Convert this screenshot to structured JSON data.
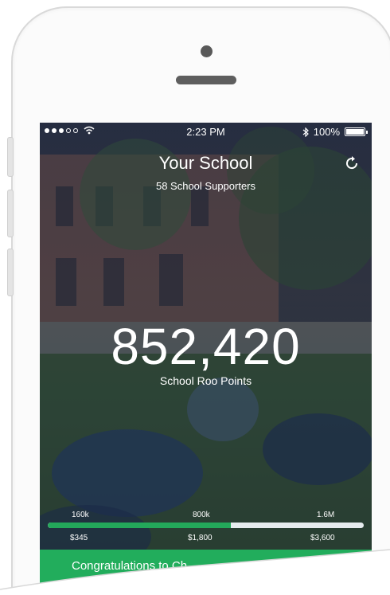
{
  "status_bar": {
    "time": "2:23 PM",
    "battery": "100%"
  },
  "header": {
    "title": "Your School",
    "subtitle": "58 School Supporters"
  },
  "icons": {
    "refresh": "refresh-icon",
    "wifi": "wifi-icon",
    "bluetooth": "bluetooth-icon",
    "battery": "battery-icon",
    "back": "chevron-left-icon"
  },
  "points": {
    "value": "852,420",
    "label": "School Roo Points"
  },
  "progress": {
    "fraction": 0.58,
    "milestones": [
      "160k",
      "800k",
      "1.6M"
    ],
    "amounts": [
      "$345",
      "$1,800",
      "$3,600"
    ]
  },
  "banner": {
    "text": "Congratulations to Ch"
  },
  "colors": {
    "accent_green": "#22ad5c",
    "overlay_navy": "#1c2842"
  }
}
